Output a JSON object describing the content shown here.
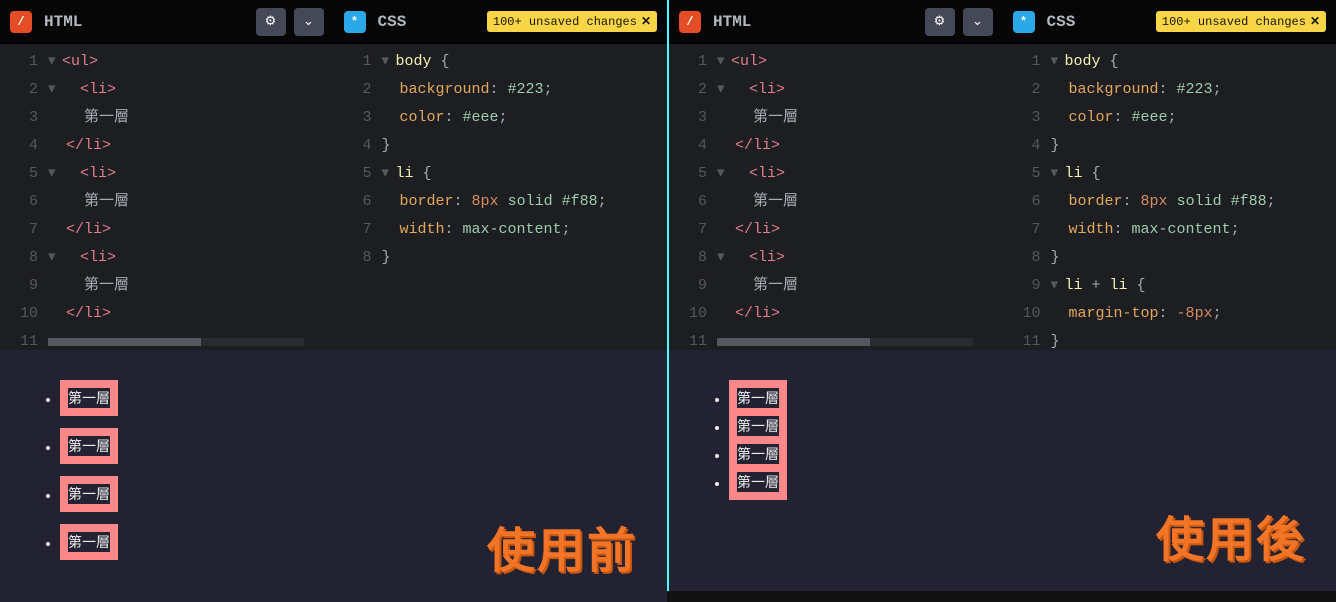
{
  "left": {
    "html": {
      "badge": "/",
      "title": "HTML",
      "lines": {
        "l1": "<ul>",
        "l2": "  <li>",
        "l3": "    第一層",
        "l4": "  </li>",
        "l5": "  <li>",
        "l6": "    第一層",
        "l7": "  </li>",
        "l8": "  <li>",
        "l9": "    第一層",
        "l10": "  </li>"
      },
      "gutter": [
        "1",
        "2",
        "3",
        "4",
        "5",
        "6",
        "7",
        "8",
        "9",
        "10",
        "11"
      ]
    },
    "css": {
      "badge": "*",
      "title": "CSS",
      "unsaved": "100+ unsaved changes",
      "close": "✕",
      "lines": {
        "l1a": "body",
        "l1b": " {",
        "l2a": "  background",
        "l2b": ": ",
        "l2c": "#223",
        "l2d": ";",
        "l3a": "  color",
        "l3b": ": ",
        "l3c": "#eee",
        "l3d": ";",
        "l4": "}",
        "l5a": "li",
        "l5b": " {",
        "l6a": "  border",
        "l6b": ": ",
        "l6c": "8",
        "l6d": "px",
        "l6e": " solid ",
        "l6f": "#f88",
        "l6g": ";",
        "l7a": "  width",
        "l7b": ": ",
        "l7c": "max-content",
        "l7d": ";",
        "l8": "}"
      },
      "gutter": [
        "1",
        "2",
        "3",
        "4",
        "5",
        "6",
        "7",
        "8"
      ]
    },
    "output": {
      "item": "第一層",
      "items": [
        "第一層",
        "第一層",
        "第一層",
        "第一層"
      ],
      "label": "使用前"
    }
  },
  "right": {
    "html": {
      "badge": "/",
      "title": "HTML",
      "lines": {
        "l1": "<ul>",
        "l2": "  <li>",
        "l3": "    第一層",
        "l4": "  </li>",
        "l5": "  <li>",
        "l6": "    第一層",
        "l7": "  </li>",
        "l8": "  <li>",
        "l9": "    第一層",
        "l10": "  </li>"
      },
      "gutter": [
        "1",
        "2",
        "3",
        "4",
        "5",
        "6",
        "7",
        "8",
        "9",
        "10",
        "11"
      ]
    },
    "css": {
      "badge": "*",
      "title": "CSS",
      "unsaved": "100+ unsaved changes",
      "close": "✕",
      "lines": {
        "l1a": "body",
        "l1b": " {",
        "l2a": "  background",
        "l2b": ": ",
        "l2c": "#223",
        "l2d": ";",
        "l3a": "  color",
        "l3b": ": ",
        "l3c": "#eee",
        "l3d": ";",
        "l4": "}",
        "l5a": "li",
        "l5b": " {",
        "l6a": "  border",
        "l6b": ": ",
        "l6c": "8",
        "l6d": "px",
        "l6e": " solid ",
        "l6f": "#f88",
        "l6g": ";",
        "l7a": "  width",
        "l7b": ": ",
        "l7c": "max-content",
        "l7d": ";",
        "l8": "}",
        "l9a": "li",
        "l9b": " + ",
        "l9c": "li",
        "l9d": " {",
        "l10a": "  margin-top",
        "l10b": ": ",
        "l10c": "-8",
        "l10d": "px",
        "l10e": ";",
        "l11": "}"
      },
      "gutter": [
        "1",
        "2",
        "3",
        "4",
        "5",
        "6",
        "7",
        "8",
        "9",
        "10",
        "11"
      ]
    },
    "output": {
      "item": "第一層",
      "items": [
        "第一層",
        "第一層",
        "第一層",
        "第一層"
      ],
      "label": "使用後"
    }
  },
  "icons": {
    "gear": "⚙",
    "chevron": "⌄"
  }
}
